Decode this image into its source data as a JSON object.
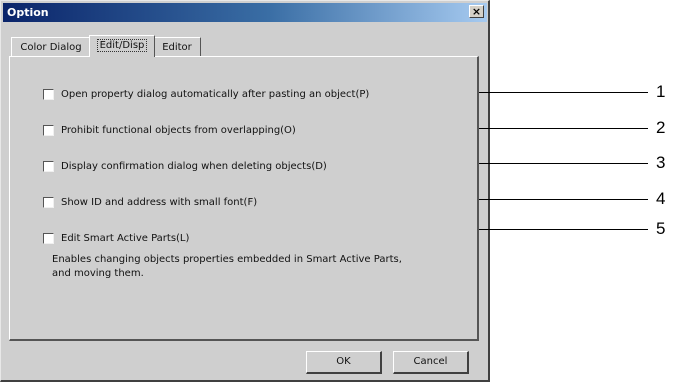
{
  "window": {
    "title": "Option",
    "close_glyph": "×"
  },
  "tabs": [
    {
      "label": "Color Dialog",
      "active": false
    },
    {
      "label": "Edit/Disp",
      "active": true
    },
    {
      "label": "Editor",
      "active": false
    }
  ],
  "options": [
    {
      "label": "Open property dialog automatically after pasting an object(P)",
      "checked": false
    },
    {
      "label": "Prohibit functional objects from overlapping(O)",
      "checked": false
    },
    {
      "label": "Display confirmation dialog when deleting objects(D)",
      "checked": false
    },
    {
      "label": "Show ID and address with small font(F)",
      "checked": false
    },
    {
      "label": "Edit Smart Active Parts(L)",
      "checked": false
    }
  ],
  "smart_parts_description": "Enables changing objects properties embedded in Smart Active Parts, and moving them.",
  "buttons": {
    "ok": "OK",
    "cancel": "Cancel"
  },
  "callouts": [
    "1",
    "2",
    "3",
    "4",
    "5"
  ]
}
